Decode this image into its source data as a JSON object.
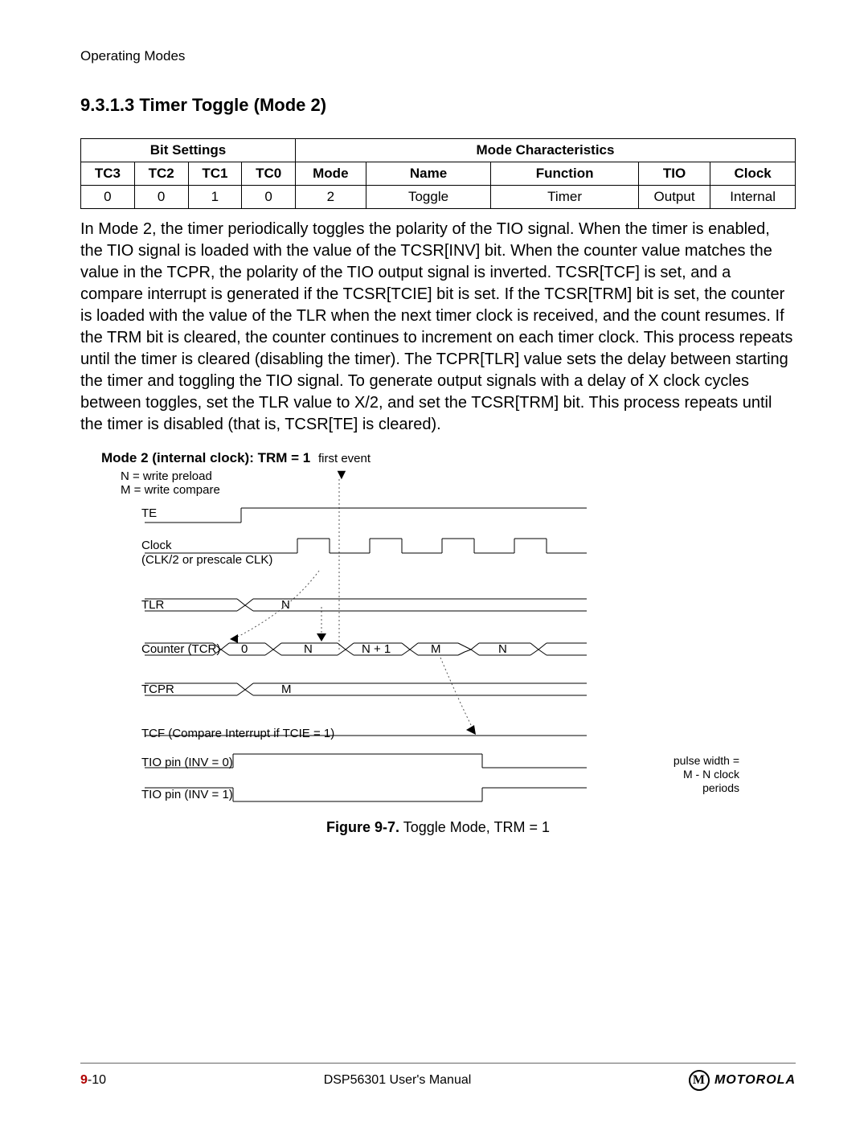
{
  "header": {
    "running": "Operating Modes"
  },
  "section": {
    "number": "9.3.1.3",
    "title": "Timer Toggle (Mode 2)"
  },
  "table": {
    "group1": "Bit Settings",
    "group2": "Mode Characteristics",
    "headers": {
      "tc3": "TC3",
      "tc2": "TC2",
      "tc1": "TC1",
      "tc0": "TC0",
      "mode": "Mode",
      "name": "Name",
      "func": "Function",
      "tio": "TIO",
      "clk": "Clock"
    },
    "row": {
      "tc3": "0",
      "tc2": "0",
      "tc1": "1",
      "tc0": "0",
      "mode": "2",
      "name": "Toggle",
      "func": "Timer",
      "tio": "Output",
      "clk": "Internal"
    }
  },
  "paragraph": "In Mode 2, the timer periodically toggles the polarity of the TIO signal. When the timer is enabled, the TIO signal is loaded with the value of the TCSR[INV] bit. When the counter value matches the value in the TCPR, the polarity of the TIO output signal is inverted. TCSR[TCF] is set, and a compare interrupt is generated if the TCSR[TCIE] bit is set. If the TCSR[TRM] bit is set, the counter is loaded with the value of the TLR when the next timer clock is received, and the count resumes. If the TRM bit is cleared, the counter continues to increment on each timer clock. This process repeats until the timer is cleared (disabling the timer). The TCPR[TLR] value sets the delay between starting the timer and toggling the TIO signal. To generate output signals with a delay of X clock cycles between toggles, set the TLR value to X/2, and set the TCSR[TRM] bit. This process repeats until the timer is disabled (that is, TCSR[TE] is cleared).",
  "figure": {
    "mode_title": "Mode 2 (internal clock): TRM = 1",
    "legend_n": "N = write preload",
    "legend_m": "M = write compare",
    "first_event": "first event",
    "labels": {
      "te": "TE",
      "clock1": "Clock",
      "clock2": "(CLK/2 or prescale CLK)",
      "tlr": "TLR",
      "counter": "Counter (TCR)",
      "tcpr": "TCPR",
      "tcf": "TCF (Compare Interrupt if TCIE = 1)",
      "tio0": "TIO pin (INV = 0)",
      "tio1": "TIO pin (INV = 1)"
    },
    "tlr_val": "N",
    "counter_vals": [
      "0",
      "N",
      "N + 1",
      "M",
      "N"
    ],
    "tcpr_val": "M",
    "pulse_note1": "pulse width =",
    "pulse_note2": "M - N clock",
    "pulse_note3": "periods",
    "caption_bold": "Figure 9-7.",
    "caption_rest": " Toggle Mode, TRM = 1"
  },
  "footer": {
    "page_prefix": "9",
    "page_suffix": "-10",
    "center": "DSP56301 User's Manual",
    "brand_badge": "M",
    "brand": "MOTOROLA"
  }
}
